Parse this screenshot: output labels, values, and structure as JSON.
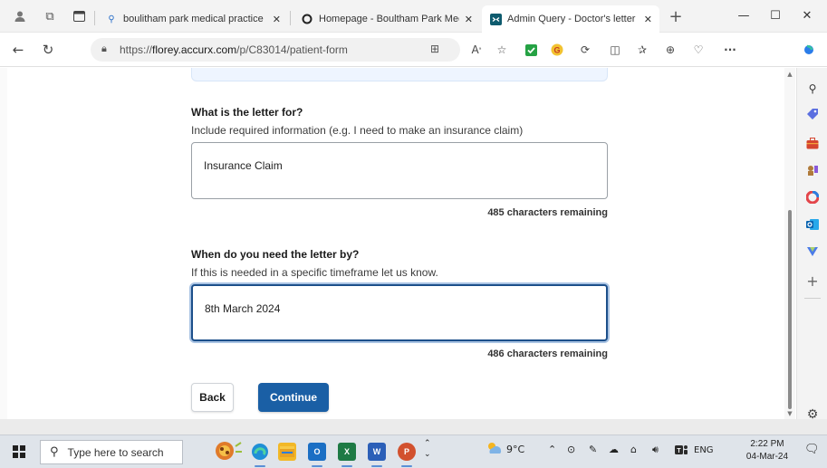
{
  "browser": {
    "tabs": [
      {
        "title": "boulitham park medical practice",
        "favicon": "search-icon",
        "active": false
      },
      {
        "title": "Homepage - Boultham Park Med",
        "favicon": "circle-icon",
        "active": false
      },
      {
        "title": "Admin Query - Doctor's letter",
        "favicon": "accurx-icon",
        "active": true
      }
    ],
    "new_tab_label": "+",
    "url_prefix": "https://",
    "url_domain": "florey.accurx.com",
    "url_path": "/p/C83014/patient-form",
    "accent_color": "#1a5fa5"
  },
  "form": {
    "q1": {
      "title": "What is the letter for?",
      "hint": "Include required information (e.g. I need to make an insurance claim)",
      "value": "Insurance Claim",
      "remaining": "485 characters remaining"
    },
    "q2": {
      "title": "When do you need the letter by?",
      "hint": "If this is needed in a specific timeframe let us know.",
      "value": "8th March 2024",
      "remaining": "486 characters remaining"
    },
    "back_label": "Back",
    "continue_label": "Continue"
  },
  "taskbar": {
    "search_placeholder": "Type here to search",
    "weather": "9°C",
    "language": "ENG",
    "time": "2:22 PM",
    "date": "04-Mar-24"
  }
}
